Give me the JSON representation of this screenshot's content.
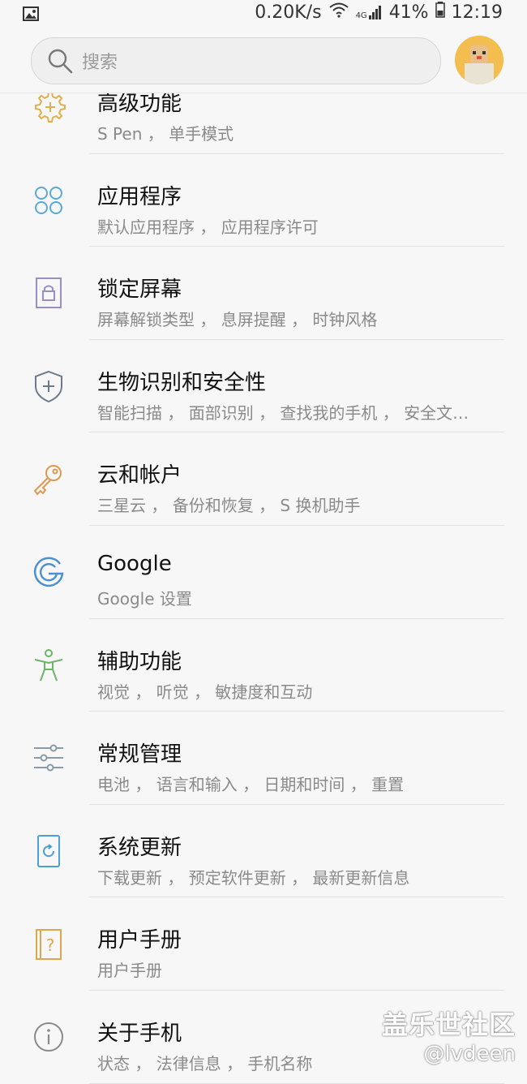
{
  "status_bar": {
    "speed": "0.20K/s",
    "battery": "41%",
    "time": "12:19",
    "network_type": "4G"
  },
  "search": {
    "placeholder": "搜索"
  },
  "items": [
    {
      "title": "高级功能",
      "subtitle": "S Pen ， 单手模式",
      "icon": "gear-plus-icon",
      "color": "#e0b04c"
    },
    {
      "title": "应用程序",
      "subtitle": "默认应用程序 ， 应用程序许可",
      "icon": "apps-grid-icon",
      "color": "#5aa9d8"
    },
    {
      "title": "锁定屏幕",
      "subtitle": "屏幕解锁类型 ， 息屏提醒 ， 时钟风格",
      "icon": "lock-icon",
      "color": "#9b8ec2"
    },
    {
      "title": "生物识别和安全性",
      "subtitle": "智能扫描 ， 面部识别 ， 查找我的手机 ， 安全文…",
      "icon": "shield-icon",
      "color": "#6b7a8c"
    },
    {
      "title": "云和帐户",
      "subtitle": "三星云 ， 备份和恢复 ， S 换机助手",
      "icon": "key-icon",
      "color": "#e09a4f"
    },
    {
      "title": "Google",
      "subtitle": "Google 设置",
      "icon": "google-icon",
      "color": "#4a8fd4"
    },
    {
      "title": "辅助功能",
      "subtitle": "视觉 ， 听觉 ， 敏捷度和互动",
      "icon": "accessibility-icon",
      "color": "#6db36a"
    },
    {
      "title": "常规管理",
      "subtitle": "电池 ， 语言和输入 ， 日期和时间 ， 重置",
      "icon": "sliders-icon",
      "color": "#8a9aa6"
    },
    {
      "title": "系统更新",
      "subtitle": "下载更新 ， 预定软件更新 ， 最新更新信息",
      "icon": "update-icon",
      "color": "#4a9fd4"
    },
    {
      "title": "用户手册",
      "subtitle": "用户手册",
      "icon": "manual-icon",
      "color": "#e0a64c"
    },
    {
      "title": "关于手机",
      "subtitle": "状态 ， 法律信息 ， 手机名称",
      "icon": "info-icon",
      "color": "#8a8a8a"
    }
  ],
  "watermark": {
    "line1": "盖乐世社区",
    "line2": "@lvdeen"
  }
}
